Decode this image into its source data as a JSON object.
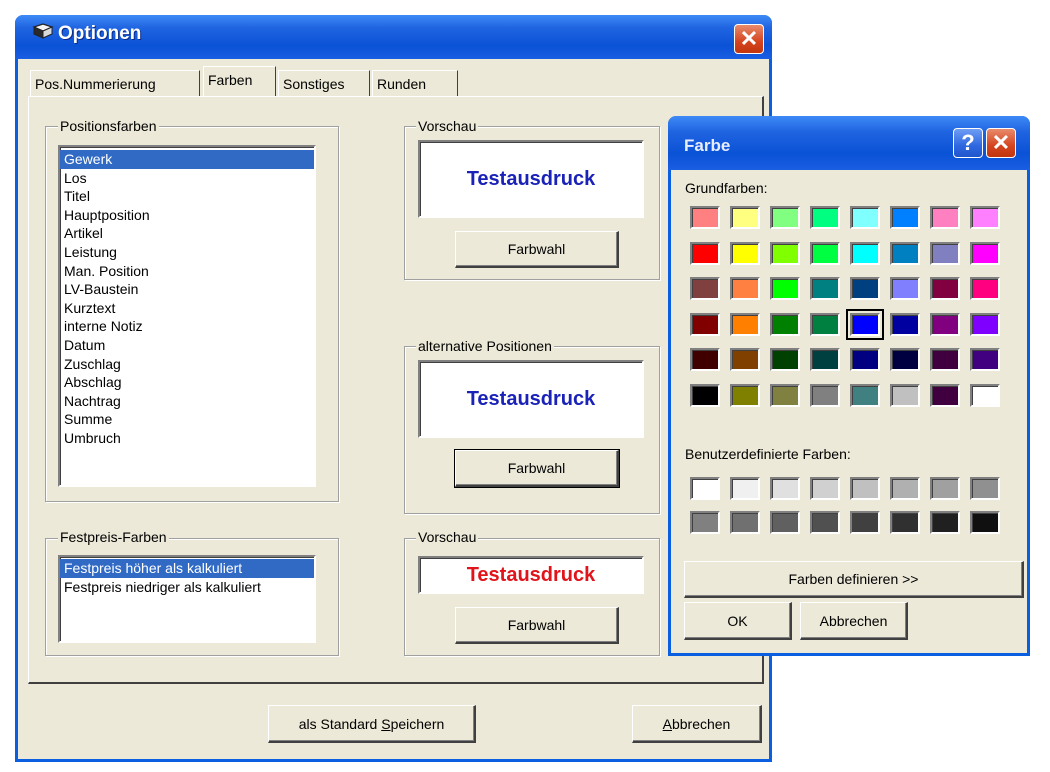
{
  "options_window": {
    "title": "Optionen",
    "tabs": [
      {
        "label": "Pos.Nummerierung",
        "active": false
      },
      {
        "label": "Farben",
        "active": true
      },
      {
        "label": "Sonstiges",
        "active": false
      },
      {
        "label": "Runden",
        "active": false
      }
    ],
    "positionsfarben": {
      "label": "Positionsfarben",
      "selected_index": 0,
      "items": [
        "Gewerk",
        "Los",
        "Titel",
        "Hauptposition",
        "Artikel",
        "Leistung",
        "Man. Position",
        "LV-Baustein",
        "Kurztext",
        "interne Notiz",
        "Datum",
        "Zuschlag",
        "Abschlag",
        "Nachtrag",
        "Summe",
        "Umbruch"
      ]
    },
    "festpreis": {
      "label": "Festpreis-Farben",
      "selected_index": 0,
      "items": [
        "Festpreis höher als kalkuliert",
        "Festpreis niedriger als kalkuliert"
      ]
    },
    "vorschau1": {
      "label": "Vorschau",
      "text": "Testausdruck",
      "color": "#1a22b8",
      "button": "Farbwahl"
    },
    "vorschau2": {
      "label": "alternative Positionen",
      "text": "Testausdruck",
      "color": "#1a22b8",
      "button": "Farbwahl"
    },
    "vorschau3": {
      "label": "Vorschau",
      "text": "Testausdruck",
      "color": "#e0141a",
      "button": "Farbwahl"
    },
    "footer": {
      "save_prefix": "als Standard ",
      "save_mnemonic": "S",
      "save_rest": "peichern",
      "cancel_mnemonic": "A",
      "cancel_rest": "bbrechen"
    }
  },
  "color_dialog": {
    "title": "Farbe",
    "basic_label": "Grundfarben:",
    "custom_label": "Benutzerdefinierte Farben:",
    "define_button": "Farben definieren >>",
    "ok_button": "OK",
    "cancel_button": "Abbrechen",
    "selected_basic": [
      3,
      4
    ],
    "basic_colors": [
      [
        "#ff8080",
        "#ffff80",
        "#80ff80",
        "#00ff80",
        "#80ffff",
        "#0080ff",
        "#ff80c0",
        "#ff80ff"
      ],
      [
        "#ff0000",
        "#ffff00",
        "#80ff00",
        "#00ff40",
        "#00ffff",
        "#0080c0",
        "#8080c0",
        "#ff00ff"
      ],
      [
        "#804040",
        "#ff8040",
        "#00ff00",
        "#008080",
        "#004080",
        "#8080ff",
        "#800040",
        "#ff0080"
      ],
      [
        "#800000",
        "#ff8000",
        "#008000",
        "#008040",
        "#0000ff",
        "#0000a0",
        "#800080",
        "#8000ff"
      ],
      [
        "#400000",
        "#804000",
        "#004000",
        "#004040",
        "#000080",
        "#000040",
        "#400040",
        "#400080"
      ],
      [
        "#000000",
        "#808000",
        "#808040",
        "#808080",
        "#408080",
        "#c0c0c0",
        "#400040",
        "#ffffff"
      ]
    ],
    "custom_colors": [
      [
        "#ffffff",
        "#f0f0f0",
        "#e0e0e0",
        "#d0d0d0",
        "#c0c0c0",
        "#b0b0b0",
        "#a0a0a0",
        "#909090"
      ],
      [
        "#808080",
        "#707070",
        "#606060",
        "#505050",
        "#404040",
        "#303030",
        "#202020",
        "#101010"
      ]
    ]
  }
}
